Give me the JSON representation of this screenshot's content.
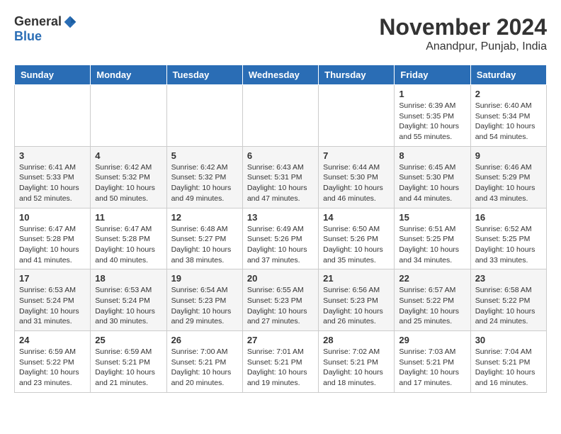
{
  "header": {
    "logo": {
      "general": "General",
      "blue": "Blue"
    },
    "title": "November 2024",
    "location": "Anandpur, Punjab, India"
  },
  "weekdays": [
    "Sunday",
    "Monday",
    "Tuesday",
    "Wednesday",
    "Thursday",
    "Friday",
    "Saturday"
  ],
  "weeks": [
    [
      {
        "day": "",
        "content": ""
      },
      {
        "day": "",
        "content": ""
      },
      {
        "day": "",
        "content": ""
      },
      {
        "day": "",
        "content": ""
      },
      {
        "day": "",
        "content": ""
      },
      {
        "day": "1",
        "content": "Sunrise: 6:39 AM\nSunset: 5:35 PM\nDaylight: 10 hours and 55 minutes."
      },
      {
        "day": "2",
        "content": "Sunrise: 6:40 AM\nSunset: 5:34 PM\nDaylight: 10 hours and 54 minutes."
      }
    ],
    [
      {
        "day": "3",
        "content": "Sunrise: 6:41 AM\nSunset: 5:33 PM\nDaylight: 10 hours and 52 minutes."
      },
      {
        "day": "4",
        "content": "Sunrise: 6:42 AM\nSunset: 5:32 PM\nDaylight: 10 hours and 50 minutes."
      },
      {
        "day": "5",
        "content": "Sunrise: 6:42 AM\nSunset: 5:32 PM\nDaylight: 10 hours and 49 minutes."
      },
      {
        "day": "6",
        "content": "Sunrise: 6:43 AM\nSunset: 5:31 PM\nDaylight: 10 hours and 47 minutes."
      },
      {
        "day": "7",
        "content": "Sunrise: 6:44 AM\nSunset: 5:30 PM\nDaylight: 10 hours and 46 minutes."
      },
      {
        "day": "8",
        "content": "Sunrise: 6:45 AM\nSunset: 5:30 PM\nDaylight: 10 hours and 44 minutes."
      },
      {
        "day": "9",
        "content": "Sunrise: 6:46 AM\nSunset: 5:29 PM\nDaylight: 10 hours and 43 minutes."
      }
    ],
    [
      {
        "day": "10",
        "content": "Sunrise: 6:47 AM\nSunset: 5:28 PM\nDaylight: 10 hours and 41 minutes."
      },
      {
        "day": "11",
        "content": "Sunrise: 6:47 AM\nSunset: 5:28 PM\nDaylight: 10 hours and 40 minutes."
      },
      {
        "day": "12",
        "content": "Sunrise: 6:48 AM\nSunset: 5:27 PM\nDaylight: 10 hours and 38 minutes."
      },
      {
        "day": "13",
        "content": "Sunrise: 6:49 AM\nSunset: 5:26 PM\nDaylight: 10 hours and 37 minutes."
      },
      {
        "day": "14",
        "content": "Sunrise: 6:50 AM\nSunset: 5:26 PM\nDaylight: 10 hours and 35 minutes."
      },
      {
        "day": "15",
        "content": "Sunrise: 6:51 AM\nSunset: 5:25 PM\nDaylight: 10 hours and 34 minutes."
      },
      {
        "day": "16",
        "content": "Sunrise: 6:52 AM\nSunset: 5:25 PM\nDaylight: 10 hours and 33 minutes."
      }
    ],
    [
      {
        "day": "17",
        "content": "Sunrise: 6:53 AM\nSunset: 5:24 PM\nDaylight: 10 hours and 31 minutes."
      },
      {
        "day": "18",
        "content": "Sunrise: 6:53 AM\nSunset: 5:24 PM\nDaylight: 10 hours and 30 minutes."
      },
      {
        "day": "19",
        "content": "Sunrise: 6:54 AM\nSunset: 5:23 PM\nDaylight: 10 hours and 29 minutes."
      },
      {
        "day": "20",
        "content": "Sunrise: 6:55 AM\nSunset: 5:23 PM\nDaylight: 10 hours and 27 minutes."
      },
      {
        "day": "21",
        "content": "Sunrise: 6:56 AM\nSunset: 5:23 PM\nDaylight: 10 hours and 26 minutes."
      },
      {
        "day": "22",
        "content": "Sunrise: 6:57 AM\nSunset: 5:22 PM\nDaylight: 10 hours and 25 minutes."
      },
      {
        "day": "23",
        "content": "Sunrise: 6:58 AM\nSunset: 5:22 PM\nDaylight: 10 hours and 24 minutes."
      }
    ],
    [
      {
        "day": "24",
        "content": "Sunrise: 6:59 AM\nSunset: 5:22 PM\nDaylight: 10 hours and 23 minutes."
      },
      {
        "day": "25",
        "content": "Sunrise: 6:59 AM\nSunset: 5:21 PM\nDaylight: 10 hours and 21 minutes."
      },
      {
        "day": "26",
        "content": "Sunrise: 7:00 AM\nSunset: 5:21 PM\nDaylight: 10 hours and 20 minutes."
      },
      {
        "day": "27",
        "content": "Sunrise: 7:01 AM\nSunset: 5:21 PM\nDaylight: 10 hours and 19 minutes."
      },
      {
        "day": "28",
        "content": "Sunrise: 7:02 AM\nSunset: 5:21 PM\nDaylight: 10 hours and 18 minutes."
      },
      {
        "day": "29",
        "content": "Sunrise: 7:03 AM\nSunset: 5:21 PM\nDaylight: 10 hours and 17 minutes."
      },
      {
        "day": "30",
        "content": "Sunrise: 7:04 AM\nSunset: 5:21 PM\nDaylight: 10 hours and 16 minutes."
      }
    ]
  ]
}
